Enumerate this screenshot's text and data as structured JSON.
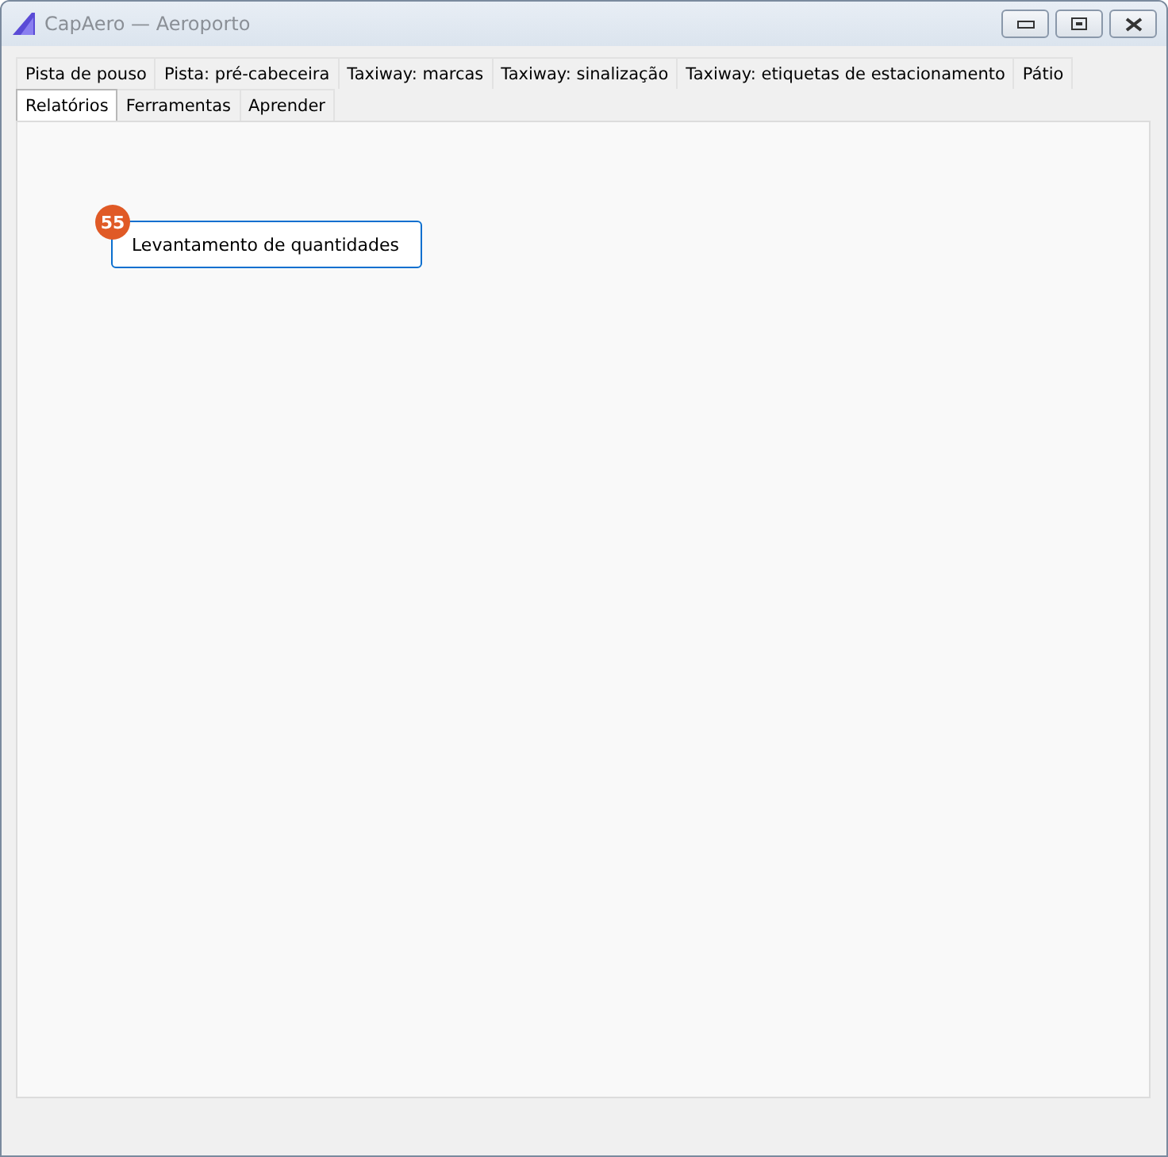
{
  "window": {
    "title": "CapAero — Aeroporto"
  },
  "tab_rows": [
    [
      {
        "label": "Pista de pouso",
        "selected": false
      },
      {
        "label": "Pista: pré-cabeceira",
        "selected": false
      },
      {
        "label": "Taxiway: marcas",
        "selected": false
      },
      {
        "label": "Taxiway: sinalização",
        "selected": false
      },
      {
        "label": "Taxiway: etiquetas de estacionamento",
        "selected": false
      },
      {
        "label": "Pátio",
        "selected": false
      }
    ],
    [
      {
        "label": "Relatórios",
        "selected": true
      },
      {
        "label": "Ferramentas",
        "selected": false
      },
      {
        "label": "Aprender",
        "selected": false
      }
    ]
  ],
  "panel": {
    "button": {
      "label": "Levantamento de quantidades",
      "badge": "55"
    }
  }
}
